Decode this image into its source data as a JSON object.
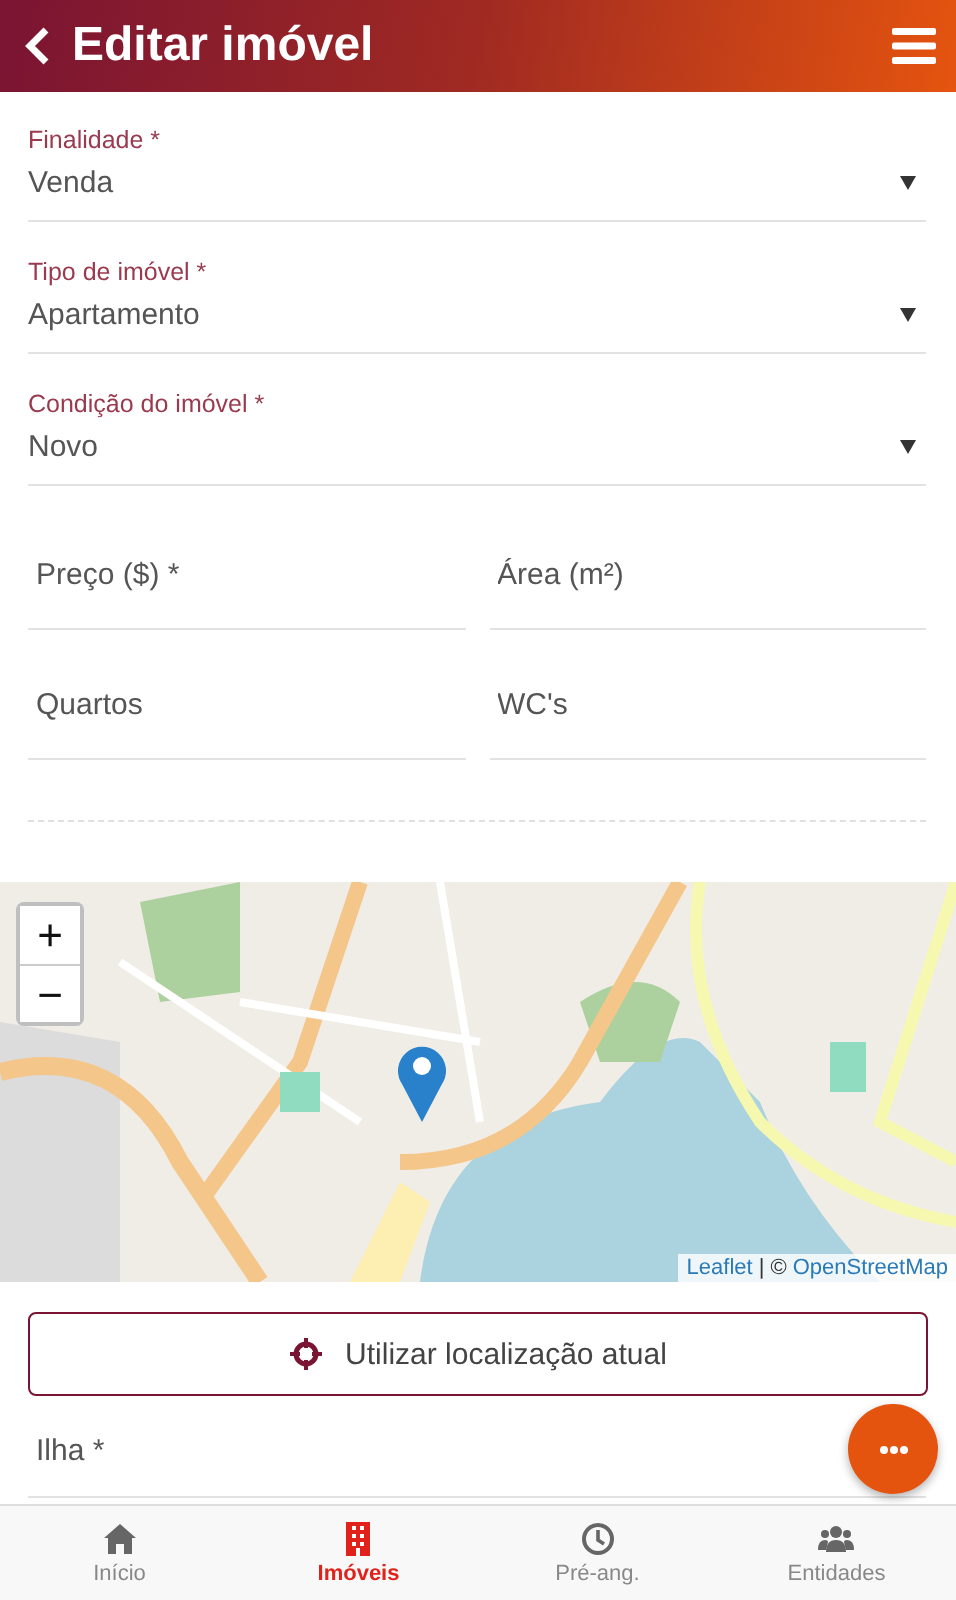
{
  "header": {
    "title": "Editar imóvel"
  },
  "selects": [
    {
      "label": "Finalidade *",
      "value": "Venda"
    },
    {
      "label": "Tipo de imóvel *",
      "value": "Apartamento"
    },
    {
      "label": "Condição do imóvel *",
      "value": "Novo"
    }
  ],
  "inputs": [
    {
      "placeholder": "Preço ($) *"
    },
    {
      "placeholder": "Área (m²)"
    },
    {
      "placeholder": "Quartos"
    },
    {
      "placeholder": "WC's"
    }
  ],
  "map": {
    "kind": "picture",
    "zoom_in": "+",
    "zoom_out": "−",
    "attribution": [
      {
        "kind": "link",
        "text": "Leaflet"
      },
      {
        "kind": "text",
        "text": "| ©"
      },
      {
        "kind": "link",
        "text": "OpenStreetMap"
      }
    ]
  },
  "location_button": {
    "label": "Utilizar localização atual"
  },
  "island_field": {
    "placeholder": "Ilha *"
  },
  "bottom_nav": [
    {
      "label": "Início",
      "kind": "home",
      "selected": false
    },
    {
      "label": "Imóveis",
      "kind": "building",
      "selected": true
    },
    {
      "label": "Pré-ang.",
      "kind": "clock",
      "selected": false
    },
    {
      "label": "Entidades",
      "kind": "users",
      "selected": false
    }
  ]
}
